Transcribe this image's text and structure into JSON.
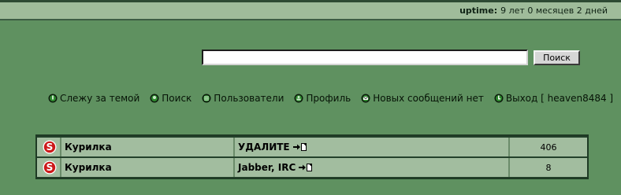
{
  "header": {
    "uptime_label": "uptime:",
    "uptime_value": "9 лет 0 месяцев 2 дней"
  },
  "search": {
    "value": "",
    "placeholder": "",
    "button_label": "Поиск"
  },
  "nav": {
    "items": [
      {
        "label": "Слежу за темой",
        "icon": "bookmark-icon"
      },
      {
        "label": "Поиск",
        "icon": "search-icon"
      },
      {
        "label": "Пользователи",
        "icon": "users-icon"
      },
      {
        "label": "Профиль",
        "icon": "profile-icon"
      },
      {
        "label": "Новых сообщений нет",
        "icon": "messages-icon"
      },
      {
        "label": "Выход [ heaven8484 ]",
        "icon": "logout-icon"
      }
    ]
  },
  "topics": [
    {
      "forum": "Курилка",
      "title": "УДАЛИТЕ",
      "count": "406",
      "icon": "forum-s-icon"
    },
    {
      "forum": "Курилка",
      "title": "Jabber, IRC",
      "count": "8",
      "icon": "forum-s-icon"
    }
  ],
  "colors": {
    "background": "#5f9160",
    "header": "#9fbc9a",
    "row": "#a2bd9f",
    "table_border": "#1e3a24"
  }
}
